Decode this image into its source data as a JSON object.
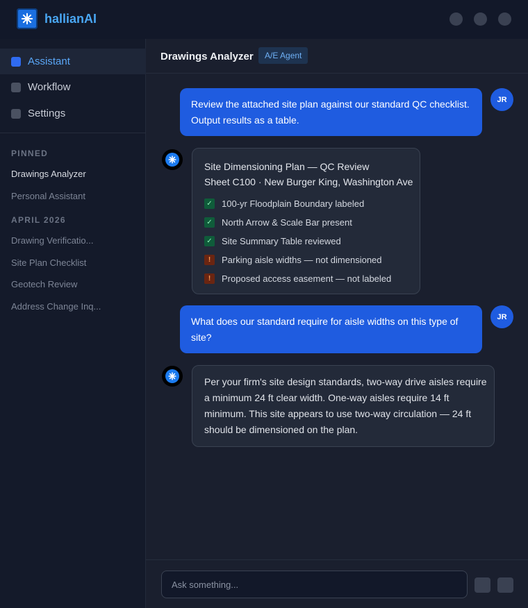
{
  "app": {
    "brand": "hallianAI"
  },
  "sidebar": {
    "nav": [
      {
        "label": "Assistant"
      },
      {
        "label": "Workflow"
      },
      {
        "label": "Settings"
      }
    ],
    "pinned_heading": "PINNED",
    "pinned": [
      {
        "label": "Drawings Analyzer"
      },
      {
        "label": "Personal Assistant"
      }
    ],
    "history_heading": "APRIL 2026",
    "history": [
      {
        "label": "Drawing Verificatio..."
      },
      {
        "label": "Site Plan Checklist"
      },
      {
        "label": "Geotech Review"
      },
      {
        "label": "Address Change Inq..."
      }
    ]
  },
  "header": {
    "title": "Drawings Analyzer",
    "badge": "A/E Agent"
  },
  "messages": {
    "user_initials": "JR",
    "user1": "Review the attached site plan against our standard QC checklist. Output results as a table.",
    "qc": {
      "title_line1": "Site Dimensioning Plan — QC Review",
      "title_line2": "Sheet C100 · New Burger King, Washington Ave",
      "items": [
        {
          "text": "100-yr Floodplain Boundary labeled",
          "status": "pass",
          "mark": "✓"
        },
        {
          "text": "North Arrow & Scale Bar present",
          "status": "pass",
          "mark": "✓"
        },
        {
          "text": "Site Summary Table reviewed",
          "status": "pass",
          "mark": "✓"
        },
        {
          "text": "Parking aisle widths — not dimensioned",
          "status": "fail",
          "mark": "!"
        },
        {
          "text": "Proposed access easement — not labeled",
          "status": "fail",
          "mark": "!"
        }
      ]
    },
    "user2": "What does our standard require for aisle widths on this type of site?",
    "bot2": "Per your firm's site design standards, two-way drive aisles require a minimum 24 ft clear width. One-way aisles require 14 ft minimum. This site appears to use two-way circulation — 24 ft should be dimensioned on the plan."
  },
  "composer": {
    "placeholder": "Ask something..."
  },
  "icons": {
    "logo": "spark-icon",
    "bot": "spark-icon"
  },
  "colors": {
    "accent": "#1f5ce0",
    "brand": "#49a6f2",
    "pass": "#0f5c3a",
    "fail": "#6a2511"
  }
}
